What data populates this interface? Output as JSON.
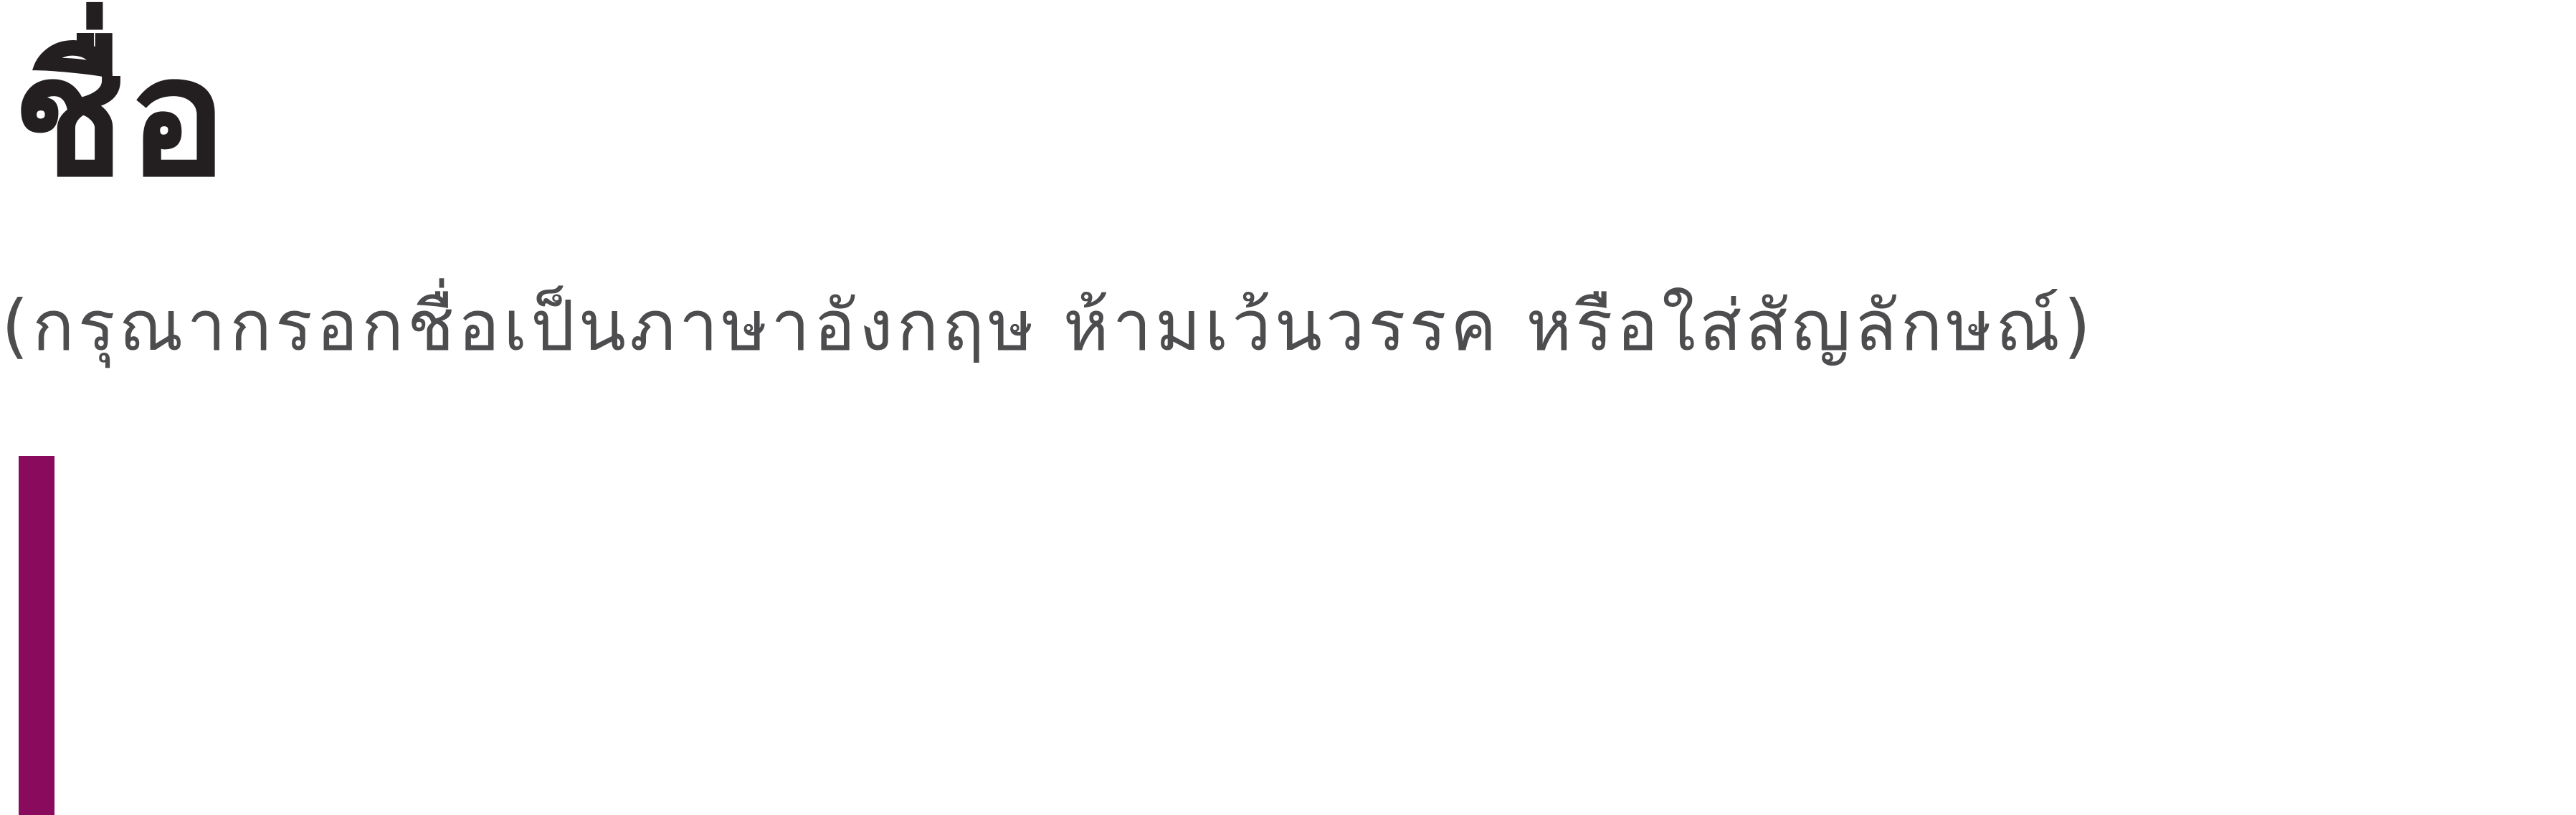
{
  "form": {
    "name_field": {
      "label": "ชื่อ",
      "hint": "(กรุณากรอกชื่อเป็นภาษาอังกฤษ ห้ามเว้นวรรค หรือใส่สัญลักษณ์)",
      "value": ""
    }
  },
  "colors": {
    "background": "#ffffff",
    "label_text": "#231f20",
    "hint_text": "#4d4d4f",
    "caret_accent": "#8a0a5e"
  }
}
